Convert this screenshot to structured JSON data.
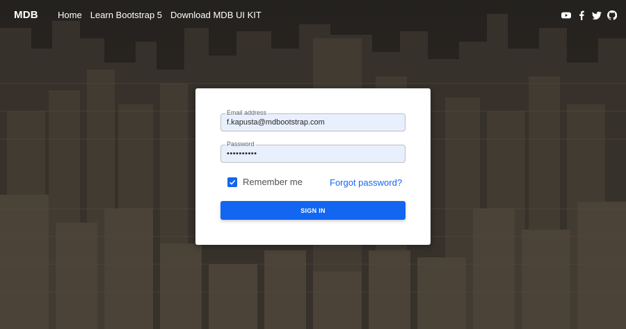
{
  "navbar": {
    "brand": "MDB",
    "links": [
      {
        "label": "Home"
      },
      {
        "label": "Learn Bootstrap 5"
      },
      {
        "label": "Download MDB UI KIT"
      }
    ],
    "social_icons": [
      "youtube-icon",
      "facebook-icon",
      "twitter-icon",
      "github-icon"
    ]
  },
  "form": {
    "email": {
      "label": "Email address",
      "value": "f.kapusta@mdbootstrap.com"
    },
    "password": {
      "label": "Password",
      "value": "••••••••••"
    },
    "remember": {
      "label": "Remember me",
      "checked": true
    },
    "forgot_label": "Forgot password?",
    "signin_label": "SIGN IN"
  },
  "colors": {
    "primary": "#1266f1",
    "input_bg": "#e8f0fe",
    "card_bg": "#ffffff",
    "text_on_dark": "#ffffff"
  }
}
